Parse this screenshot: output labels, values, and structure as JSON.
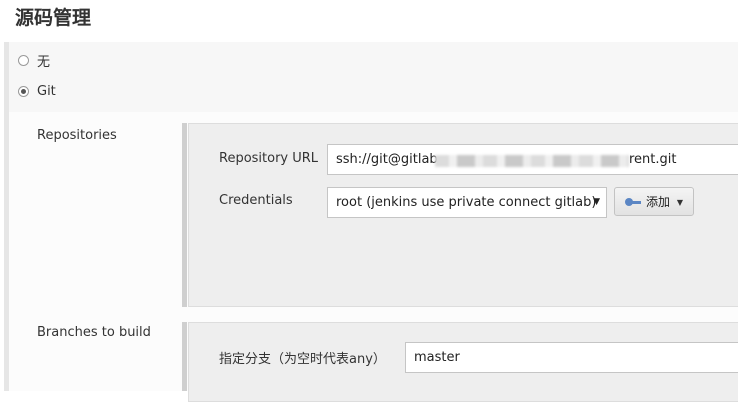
{
  "page_title": "源码管理",
  "scm_options": [
    {
      "label": "无",
      "checked": false
    },
    {
      "label": "Git",
      "checked": true
    }
  ],
  "repositories": {
    "section_label": "Repositories",
    "url_label": "Repository URL",
    "url_prefix": "ssh://git@gitlab",
    "url_suffix": "rent.git",
    "credentials_label": "Credentials",
    "credentials_value": "root (jenkins use private connect gitlab)",
    "add_button_label": "添加"
  },
  "branches": {
    "section_label": "Branches to build",
    "branch_label": "指定分支（为空时代表any）",
    "branch_value": "master"
  }
}
